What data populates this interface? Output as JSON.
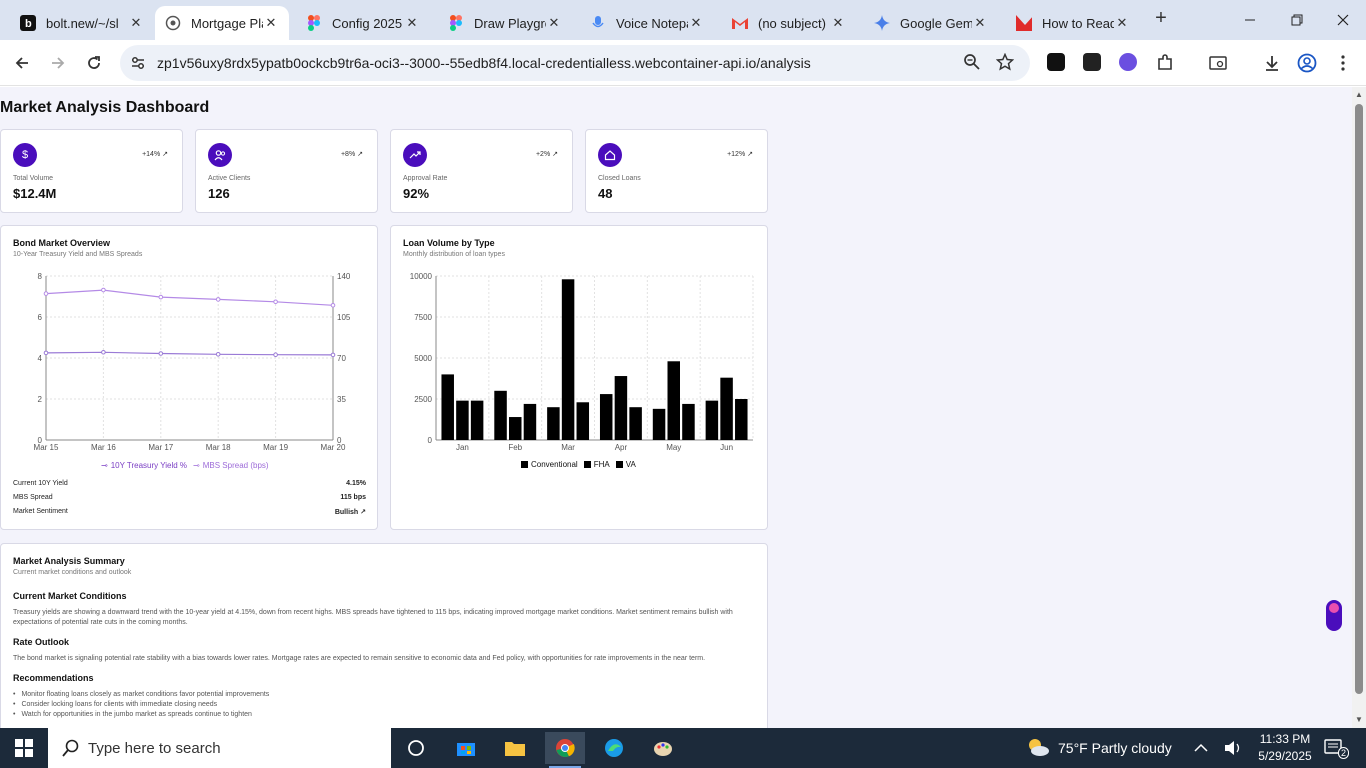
{
  "browser": {
    "tabs": [
      {
        "title": "bolt.new/~/sl",
        "icon": "bolt-icon"
      },
      {
        "title": "Mortgage Pla",
        "icon": "globe-icon",
        "active": true
      },
      {
        "title": "Config 2025",
        "icon": "figma-icon"
      },
      {
        "title": "Draw Playgro",
        "icon": "figma-icon"
      },
      {
        "title": "Voice Notepa",
        "icon": "mic-icon"
      },
      {
        "title": "(no subject) -",
        "icon": "gmail-icon"
      },
      {
        "title": "Google Gem",
        "icon": "gemini-icon"
      },
      {
        "title": "How to Read",
        "icon": "red-icon"
      }
    ],
    "url": "zp1v56uxy8rdx5ypatb0ockcb9tr6a-oci3--3000--55edb8f4.local-credentialless.webcontainer-api.io/analysis"
  },
  "page": {
    "title": "Market Analysis Dashboard",
    "accent": "#4a0dbc",
    "stats": [
      {
        "label": "Total Volume",
        "value": "$12.4M",
        "change": "+14%",
        "icon": "dollar-icon"
      },
      {
        "label": "Active Clients",
        "value": "126",
        "change": "+8%",
        "icon": "users-icon"
      },
      {
        "label": "Approval Rate",
        "value": "92%",
        "change": "+2%",
        "icon": "trending-icon"
      },
      {
        "label": "Closed Loans",
        "value": "48",
        "change": "+12%",
        "icon": "home-icon"
      }
    ],
    "bond": {
      "title": "Bond Market Overview",
      "subtitle": "10-Year Treasury Yield and MBS Spreads",
      "rows": [
        {
          "label": "Current 10Y Yield",
          "value": "4.15%"
        },
        {
          "label": "MBS Spread",
          "value": "115 bps"
        },
        {
          "label": "Market Sentiment",
          "value": "Bullish ↗"
        }
      ]
    },
    "loans": {
      "title": "Loan Volume by Type",
      "subtitle": "Monthly distribution of loan types"
    },
    "summary": {
      "title": "Market Analysis Summary",
      "subtitle": "Current market conditions and outlook",
      "h1": "Current Market Conditions",
      "p1": "Treasury yields are showing a downward trend with the 10-year yield at 4.15%, down from recent highs. MBS spreads have tightened to 115 bps, indicating improved mortgage market conditions. Market sentiment remains bullish with expectations of potential rate cuts in the coming months.",
      "h2": "Rate Outlook",
      "p2": "The bond market is signaling potential rate stability with a bias towards lower rates. Mortgage rates are expected to remain sensitive to economic data and Fed policy, with opportunities for rate improvements in the near term.",
      "h3": "Recommendations",
      "recs": [
        "Monitor floating loans closely as market conditions favor potential improvements",
        "Consider locking loans for clients with immediate closing needs",
        "Watch for opportunities in the jumbo market as spreads continue to tighten"
      ]
    }
  },
  "chart_data": [
    {
      "type": "line",
      "x": [
        "Mar 15",
        "Mar 16",
        "Mar 17",
        "Mar 18",
        "Mar 19",
        "Mar 20"
      ],
      "series": [
        {
          "name": "10Y Treasury Yield %",
          "axis": "left",
          "color": "#9a7ad6",
          "values": [
            4.25,
            4.28,
            4.22,
            4.18,
            4.16,
            4.15
          ]
        },
        {
          "name": "MBS Spread (bps)",
          "axis": "right",
          "color": "#b48ae6",
          "values": [
            125,
            128,
            122,
            120,
            118,
            115
          ]
        }
      ],
      "ylim_left": [
        0,
        8
      ],
      "yticks_left": [
        "0",
        "2",
        "4",
        "6",
        "8"
      ],
      "ylim_right": [
        0,
        140
      ],
      "yticks_right": [
        "0",
        "35",
        "70",
        "105",
        "140"
      ],
      "grid": true,
      "legend": "bottom"
    },
    {
      "type": "bar",
      "categories": [
        "Jan",
        "Feb",
        "Mar",
        "Apr",
        "May",
        "Jun"
      ],
      "series": [
        {
          "name": "Conventional",
          "values": [
            4000,
            3000,
            2000,
            2800,
            1900,
            2400
          ]
        },
        {
          "name": "FHA",
          "values": [
            2400,
            1400,
            9800,
            3900,
            4800,
            3800
          ]
        },
        {
          "name": "VA",
          "values": [
            2400,
            2200,
            2300,
            2000,
            2200,
            2500
          ]
        }
      ],
      "ylim": [
        0,
        10000
      ],
      "yticks": [
        "0",
        "2500",
        "5000",
        "7500",
        "10000"
      ],
      "grid": true,
      "legend": "bottom"
    }
  ],
  "taskbar": {
    "search_placeholder": "Type here to search",
    "weather": "75°F  Partly cloudy",
    "time": "11:33 PM",
    "date": "5/29/2025",
    "notifications": "2"
  }
}
